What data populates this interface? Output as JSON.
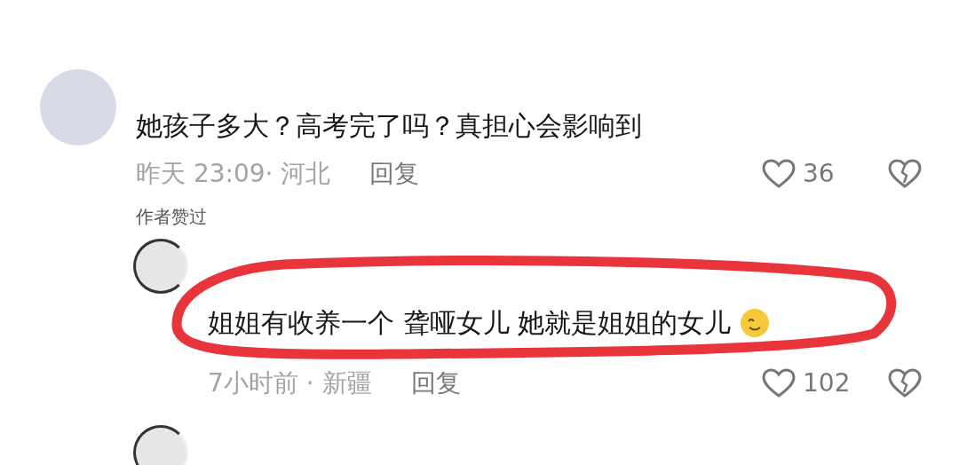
{
  "comments": [
    {
      "kind": "full",
      "text": "她孩子多大？高考完了吗？真担心会影响到",
      "meta": "昨天 23:09· 河北",
      "reply": "回复",
      "likes": "36",
      "author_liked": "作者赞过",
      "children": [
        {
          "kind": "full",
          "text": "姐姐有收养一个 聋哑女儿 她就是姐姐的女儿",
          "meta": "7小时前 · 新疆",
          "reply": "回复",
          "likes": "102",
          "highlighted": true,
          "emoji": true
        },
        {
          "kind": "partial"
        }
      ]
    }
  ]
}
